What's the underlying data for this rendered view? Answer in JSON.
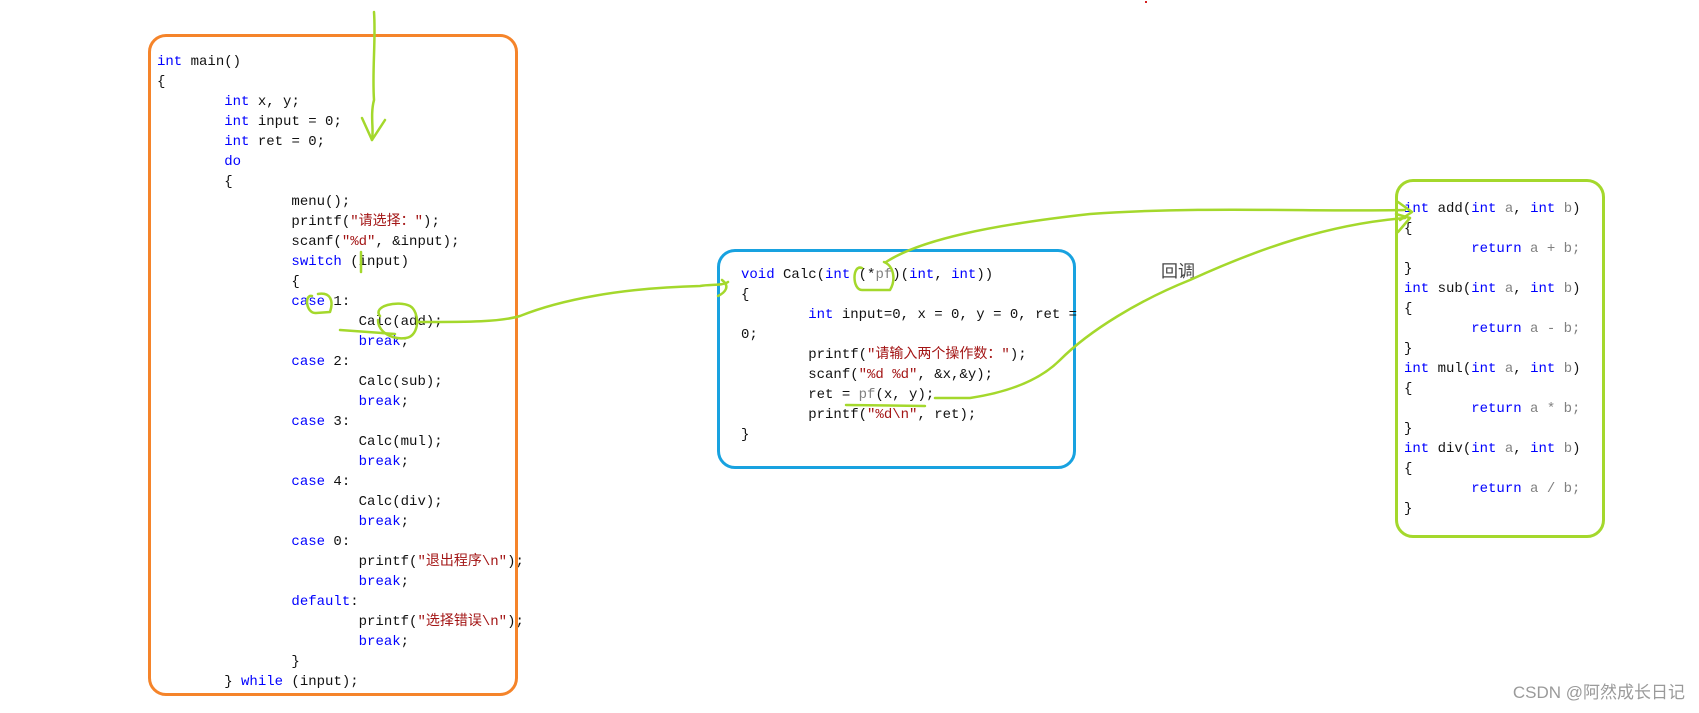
{
  "colors": {
    "main_box_border": "#f5842a",
    "calc_box_border": "#18a2e0",
    "ops_box_border": "#a4d82c",
    "annotation": "#a4d82c",
    "keyword": "#0000ff",
    "string": "#a31515",
    "identifier_gray": "#808080"
  },
  "main_function": {
    "lines": [
      [
        {
          "t": "int",
          "c": "kw"
        },
        {
          "t": " main()"
        }
      ],
      [
        {
          "t": "{"
        }
      ],
      [
        {
          "t": "\t"
        },
        {
          "t": "int",
          "c": "kw"
        },
        {
          "t": " x, y;"
        }
      ],
      [
        {
          "t": "\t"
        },
        {
          "t": "int",
          "c": "kw"
        },
        {
          "t": " input = 0;"
        }
      ],
      [
        {
          "t": "\t"
        },
        {
          "t": "int",
          "c": "kw"
        },
        {
          "t": " ret = 0;"
        }
      ],
      [
        {
          "t": "\t"
        },
        {
          "t": "do",
          "c": "kw"
        }
      ],
      [
        {
          "t": "\t{"
        }
      ],
      [
        {
          "t": "\t\tmenu();"
        }
      ],
      [
        {
          "t": "\t\tprintf("
        },
        {
          "t": "\"请选择：\"",
          "c": "str"
        },
        {
          "t": ");"
        }
      ],
      [
        {
          "t": "\t\tscanf("
        },
        {
          "t": "\"%d\"",
          "c": "str"
        },
        {
          "t": ", &input);"
        }
      ],
      [
        {
          "t": "\t\t"
        },
        {
          "t": "switch",
          "c": "kw"
        },
        {
          "t": " (input)"
        }
      ],
      [
        {
          "t": "\t\t{"
        }
      ],
      [
        {
          "t": "\t\t"
        },
        {
          "t": "case",
          "c": "kw"
        },
        {
          "t": " 1:"
        }
      ],
      [
        {
          "t": "\t\t\tCalc(add);"
        }
      ],
      [
        {
          "t": "\t\t\t"
        },
        {
          "t": "break",
          "c": "kw"
        },
        {
          "t": ";"
        }
      ],
      [
        {
          "t": "\t\t"
        },
        {
          "t": "case",
          "c": "kw"
        },
        {
          "t": " 2:"
        }
      ],
      [
        {
          "t": "\t\t\tCalc(sub);"
        }
      ],
      [
        {
          "t": "\t\t\t"
        },
        {
          "t": "break",
          "c": "kw"
        },
        {
          "t": ";"
        }
      ],
      [
        {
          "t": "\t\t"
        },
        {
          "t": "case",
          "c": "kw"
        },
        {
          "t": " 3:"
        }
      ],
      [
        {
          "t": "\t\t\tCalc(mul);"
        }
      ],
      [
        {
          "t": "\t\t\t"
        },
        {
          "t": "break",
          "c": "kw"
        },
        {
          "t": ";"
        }
      ],
      [
        {
          "t": "\t\t"
        },
        {
          "t": "case",
          "c": "kw"
        },
        {
          "t": " 4:"
        }
      ],
      [
        {
          "t": "\t\t\tCalc(div);"
        }
      ],
      [
        {
          "t": "\t\t\t"
        },
        {
          "t": "break",
          "c": "kw"
        },
        {
          "t": ";"
        }
      ],
      [
        {
          "t": "\t\t"
        },
        {
          "t": "case",
          "c": "kw"
        },
        {
          "t": " 0:"
        }
      ],
      [
        {
          "t": "\t\t\tprintf("
        },
        {
          "t": "\"退出程序\\n\"",
          "c": "str"
        },
        {
          "t": ");"
        }
      ],
      [
        {
          "t": "\t\t\t"
        },
        {
          "t": "break",
          "c": "kw"
        },
        {
          "t": ";"
        }
      ],
      [
        {
          "t": "\t\t"
        },
        {
          "t": "default",
          "c": "kw"
        },
        {
          "t": ":"
        }
      ],
      [
        {
          "t": "\t\t\tprintf("
        },
        {
          "t": "\"选择错误\\n\"",
          "c": "str"
        },
        {
          "t": ");"
        }
      ],
      [
        {
          "t": "\t\t\t"
        },
        {
          "t": "break",
          "c": "kw"
        },
        {
          "t": ";"
        }
      ],
      [
        {
          "t": "\t\t}"
        }
      ],
      [
        {
          "t": "\t} "
        },
        {
          "t": "while",
          "c": "kw"
        },
        {
          "t": " (input);"
        }
      ]
    ]
  },
  "calc_function": {
    "lines": [
      [
        {
          "t": "void",
          "c": "kw"
        },
        {
          "t": " Calc("
        },
        {
          "t": "int",
          "c": "kw"
        },
        {
          "t": " (*"
        },
        {
          "t": "pf",
          "c": "id"
        },
        {
          "t": ")("
        },
        {
          "t": "int",
          "c": "kw"
        },
        {
          "t": ", "
        },
        {
          "t": "int",
          "c": "kw"
        },
        {
          "t": "))"
        }
      ],
      [
        {
          "t": "{"
        }
      ],
      [
        {
          "t": "\t"
        },
        {
          "t": "int",
          "c": "kw"
        },
        {
          "t": " input=0, x = 0, y = 0, ret ="
        }
      ],
      [
        {
          "t": "0;"
        }
      ],
      [
        {
          "t": "\tprintf("
        },
        {
          "t": "\"请输入两个操作数：\"",
          "c": "str"
        },
        {
          "t": ");"
        }
      ],
      [
        {
          "t": "\tscanf("
        },
        {
          "t": "\"%d %d\"",
          "c": "str"
        },
        {
          "t": ", &x,&y);"
        }
      ],
      [
        {
          "t": "\tret = "
        },
        {
          "t": "pf",
          "c": "id"
        },
        {
          "t": "(x, y);"
        }
      ],
      [
        {
          "t": "\tprintf("
        },
        {
          "t": "\"%d\\n\"",
          "c": "str"
        },
        {
          "t": ", ret);"
        }
      ],
      [
        {
          "t": "}"
        }
      ]
    ]
  },
  "operator_functions": {
    "lines": [
      [
        {
          "t": "int",
          "c": "kw"
        },
        {
          "t": " add("
        },
        {
          "t": "int",
          "c": "kw"
        },
        {
          "t": " a",
          "c": "id"
        },
        {
          "t": ", "
        },
        {
          "t": "int",
          "c": "kw"
        },
        {
          "t": " b",
          "c": "id"
        },
        {
          "t": ")"
        }
      ],
      [
        {
          "t": "{"
        }
      ],
      [
        {
          "t": "\t"
        },
        {
          "t": "return",
          "c": "kw"
        },
        {
          "t": " a + b;",
          "c": "id"
        }
      ],
      [
        {
          "t": "}"
        }
      ],
      [
        {
          "t": "int",
          "c": "kw"
        },
        {
          "t": " sub("
        },
        {
          "t": "int",
          "c": "kw"
        },
        {
          "t": " a",
          "c": "id"
        },
        {
          "t": ", "
        },
        {
          "t": "int",
          "c": "kw"
        },
        {
          "t": " b",
          "c": "id"
        },
        {
          "t": ")"
        }
      ],
      [
        {
          "t": "{"
        }
      ],
      [
        {
          "t": "\t"
        },
        {
          "t": "return",
          "c": "kw"
        },
        {
          "t": " a - b;",
          "c": "id"
        }
      ],
      [
        {
          "t": "}"
        }
      ],
      [
        {
          "t": "int",
          "c": "kw"
        },
        {
          "t": " mul("
        },
        {
          "t": "int",
          "c": "kw"
        },
        {
          "t": " a",
          "c": "id"
        },
        {
          "t": ", "
        },
        {
          "t": "int",
          "c": "kw"
        },
        {
          "t": " b",
          "c": "id"
        },
        {
          "t": ")"
        }
      ],
      [
        {
          "t": "{"
        }
      ],
      [
        {
          "t": "\t"
        },
        {
          "t": "return",
          "c": "kw"
        },
        {
          "t": " a * b;",
          "c": "id"
        }
      ],
      [
        {
          "t": "}"
        }
      ],
      [
        {
          "t": "int",
          "c": "kw"
        },
        {
          "t": " div("
        },
        {
          "t": "int",
          "c": "kw"
        },
        {
          "t": " a",
          "c": "id"
        },
        {
          "t": ", "
        },
        {
          "t": "int",
          "c": "kw"
        },
        {
          "t": " b",
          "c": "id"
        },
        {
          "t": ")"
        }
      ],
      [
        {
          "t": "{"
        }
      ],
      [
        {
          "t": "\t"
        },
        {
          "t": "return",
          "c": "kw"
        },
        {
          "t": " a / b;",
          "c": "id"
        }
      ],
      [
        {
          "t": "}"
        }
      ]
    ]
  },
  "annotations": {
    "callback_label": "回调"
  },
  "watermark": "CSDN @阿然成长日记"
}
